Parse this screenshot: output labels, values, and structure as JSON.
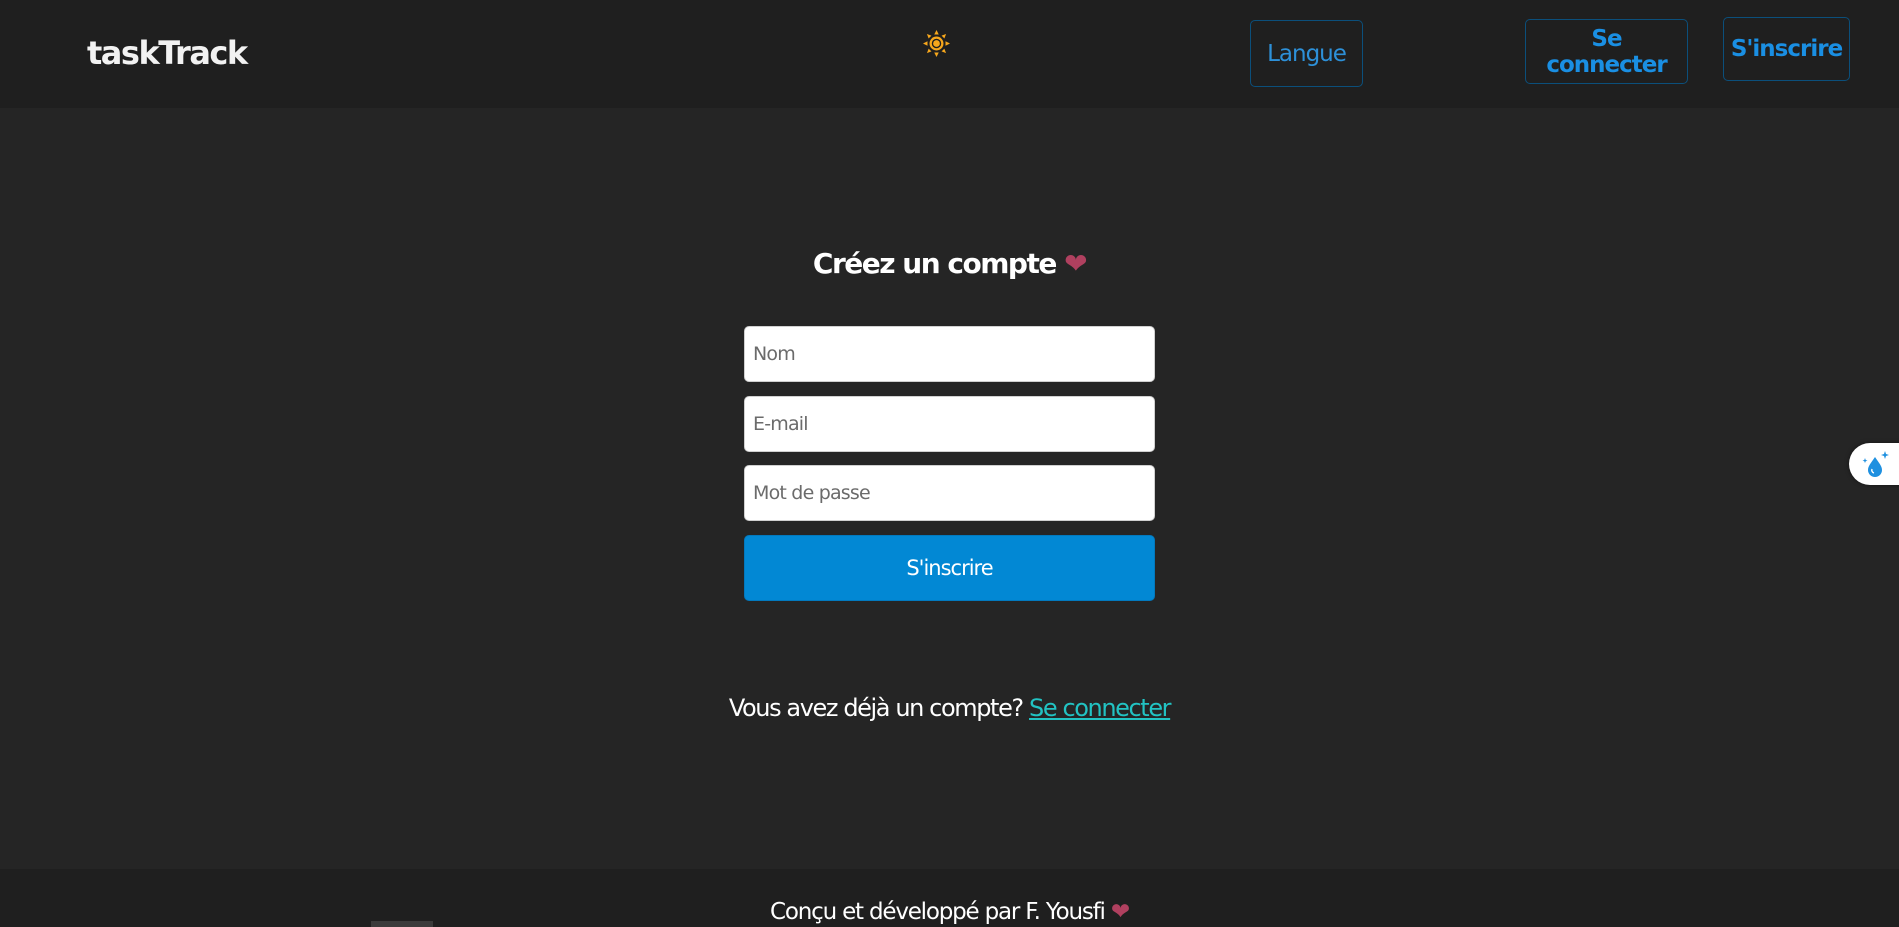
{
  "navbar": {
    "brand": "taskTrack",
    "theme_icon": "sun-icon",
    "lang_label": "Langue",
    "login_label": "Se connecter",
    "signup_label": "S'inscrire"
  },
  "form": {
    "title": "Créez un compte",
    "title_icon": "heart-icon",
    "name_placeholder": "Nom",
    "email_placeholder": "E-mail",
    "password_placeholder": "Mot de passe",
    "submit_label": "S'inscrire"
  },
  "login_prompt": {
    "text": "Vous avez déjà un compte?",
    "link": "Se connecter"
  },
  "side_widget": {
    "icon": "droplet-sparkle-icon"
  },
  "footer": {
    "text": "Conçu et développé par F. Yousfi",
    "icon": "heart-icon"
  },
  "colors": {
    "accent": "#0288d4",
    "link": "#22c3c3",
    "heart": "#b0405f",
    "background": "#252525",
    "navbar": "#1f1f1f"
  }
}
